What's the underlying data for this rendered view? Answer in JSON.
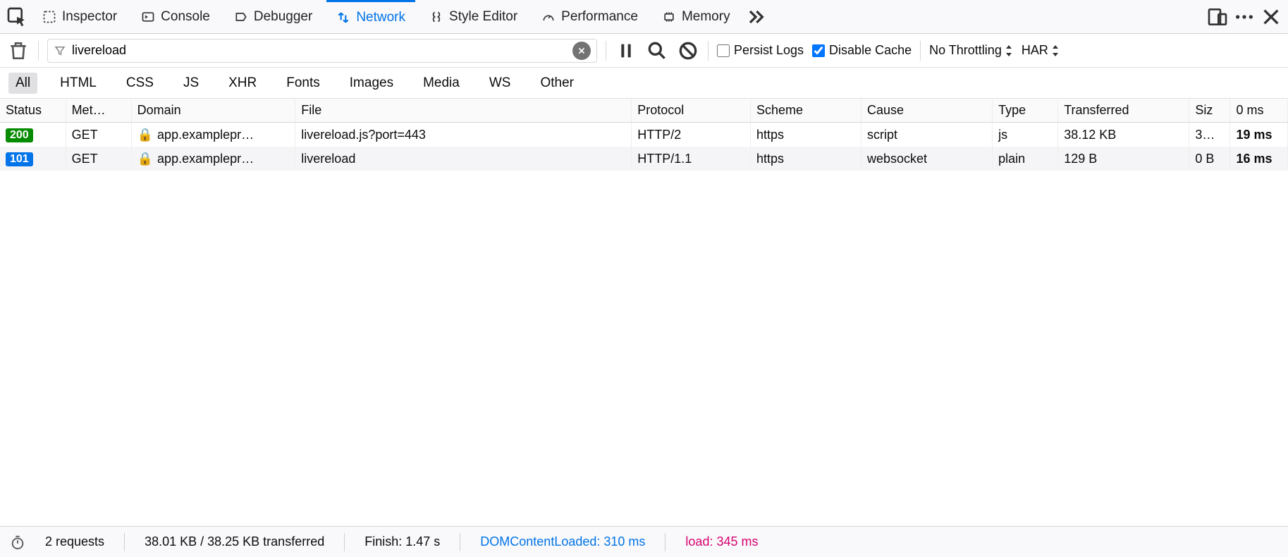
{
  "tabs": {
    "inspector": "Inspector",
    "console": "Console",
    "debugger": "Debugger",
    "network": "Network",
    "style_editor": "Style Editor",
    "performance": "Performance",
    "memory": "Memory"
  },
  "toolbar": {
    "filter_value": "livereload",
    "persist_logs_label": "Persist Logs",
    "persist_logs_checked": false,
    "disable_cache_label": "Disable Cache",
    "disable_cache_checked": true,
    "throttling_label": "No Throttling",
    "har_label": "HAR"
  },
  "type_filters": [
    "All",
    "HTML",
    "CSS",
    "JS",
    "XHR",
    "Fonts",
    "Images",
    "Media",
    "WS",
    "Other"
  ],
  "type_filter_active": "All",
  "columns": {
    "status": "Status",
    "method": "Met…",
    "domain": "Domain",
    "file": "File",
    "protocol": "Protocol",
    "scheme": "Scheme",
    "cause": "Cause",
    "type": "Type",
    "transferred": "Transferred",
    "size": "Siz",
    "time": "0 ms"
  },
  "requests": [
    {
      "status_code": "200",
      "status_class": "status-200",
      "method": "GET",
      "domain": "app.examplepr…",
      "file": "livereload.js?port=443",
      "protocol": "HTTP/2",
      "scheme": "https",
      "cause": "script",
      "type": "js",
      "transferred": "38.12 KB",
      "size": "3…",
      "time": "19 ms",
      "secure": true
    },
    {
      "status_code": "101",
      "status_class": "status-101",
      "method": "GET",
      "domain": "app.examplepr…",
      "file": "livereload",
      "protocol": "HTTP/1.1",
      "scheme": "https",
      "cause": "websocket",
      "type": "plain",
      "transferred": "129 B",
      "size": "0 B",
      "time": "16 ms",
      "secure": true
    }
  ],
  "footer": {
    "request_count": "2 requests",
    "transferred_summary": "38.01 KB / 38.25 KB transferred",
    "finish": "Finish: 1.47 s",
    "dcl": "DOMContentLoaded: 310 ms",
    "load": "load: 345 ms"
  }
}
